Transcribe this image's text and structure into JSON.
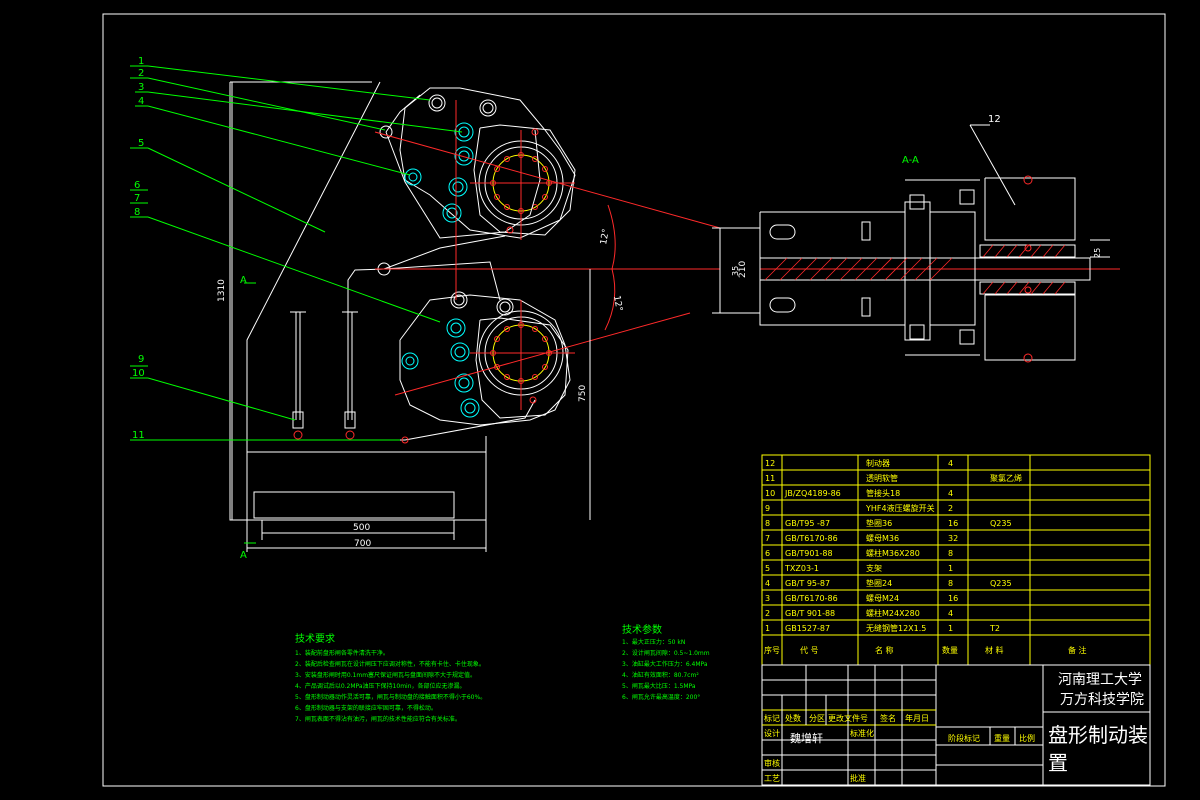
{
  "drawing": {
    "section_label": "A-A",
    "view_marker_top": "A",
    "view_marker_bottom": "A",
    "dimensions": {
      "height_total": "1310",
      "height_lower": "750",
      "width_500": "500",
      "width_700": "700",
      "angle_upper": "12°",
      "angle_lower": "12°",
      "gap_210": "210",
      "dim_35": "35",
      "dim_25": "25"
    },
    "callouts": [
      "1",
      "2",
      "3",
      "4",
      "5",
      "6",
      "7",
      "8",
      "9",
      "10",
      "11",
      "12"
    ]
  },
  "parts_table": {
    "header": {
      "seq": "序号",
      "code": "代 号",
      "name": "名 称",
      "qty": "数量",
      "material": "材 料",
      "note": "备 注"
    },
    "rows": [
      {
        "seq": "12",
        "code": "",
        "name": "制动器",
        "qty": "4",
        "material": "",
        "note": ""
      },
      {
        "seq": "11",
        "code": "",
        "name": "透明软管",
        "qty": "",
        "material": "",
        "note": "",
        "extra": "聚氯乙烯"
      },
      {
        "seq": "10",
        "code": "JB/ZQ4189-86",
        "name": "管接头18",
        "qty": "4",
        "material": "",
        "note": ""
      },
      {
        "seq": "9",
        "code": "",
        "name": "YHF4液压螺旋开关",
        "qty": "2",
        "material": "",
        "note": ""
      },
      {
        "seq": "8",
        "code": "GB/T95 -87",
        "name": "垫圈36",
        "qty": "16",
        "material": "Q235",
        "note": ""
      },
      {
        "seq": "7",
        "code": "GB/T6170-86",
        "name": "螺母M36",
        "qty": "32",
        "material": "",
        "note": ""
      },
      {
        "seq": "6",
        "code": "GB/T901-88",
        "name": "螺柱M36X280",
        "qty": "8",
        "material": "",
        "note": ""
      },
      {
        "seq": "5",
        "code": "TXZ03-1",
        "name": "支架",
        "qty": "1",
        "material": "",
        "note": ""
      },
      {
        "seq": "4",
        "code": "GB/T 95-87",
        "name": "垫圈24",
        "qty": "8",
        "material": "Q235",
        "note": ""
      },
      {
        "seq": "3",
        "code": "GB/T6170-86",
        "name": "螺母M24",
        "qty": "16",
        "material": "",
        "note": ""
      },
      {
        "seq": "2",
        "code": "GB/T 901-88",
        "name": "螺柱M24X280",
        "qty": "4",
        "material": "",
        "note": ""
      },
      {
        "seq": "1",
        "code": "GB1527-87",
        "name": "无缝钢管12X1.5",
        "qty": "1",
        "material": "T2",
        "note": ""
      }
    ]
  },
  "title_block": {
    "school_line1": "河南理工大学",
    "school_line2": "万方科技学院",
    "drawing_title_line1": "盘形制动装",
    "drawing_title_line2": "置",
    "labels": {
      "mark": "标记",
      "count": "处数",
      "zone": "分区",
      "change_doc": "更改文件号",
      "sign": "签名",
      "date": "年月日",
      "design": "设计",
      "standard": "标准化",
      "review": "审核",
      "process": "工艺",
      "approve": "批准",
      "stage": "阶段标记",
      "weight": "重量",
      "scale": "比例"
    },
    "designer": "魏增轩"
  },
  "notes": {
    "left_title": "技术要求",
    "left_lines": [
      "1、装配前盘形闸各零件清洗干净。",
      "2、装配后检查闸瓦在设计闸压下应调对称性，不能有卡住、卡住现象。",
      "3、安装盘形闸时用0.1mm塞尺保证闸瓦与盘面间隙不大于规定值。",
      "4、产品调试后以0.2MPa油压下保持10min，各部位应无渗漏。",
      "5、盘形制动器动作灵活可靠，闸瓦与制动盘的接触面积不得小于60%。",
      "6、盘形制动器与支架的联接应牢固可靠，不得松动。",
      "7、闸瓦表面不得沾有油污，闸瓦的技术性能应符合有关标准。"
    ],
    "right_title": "技术参数",
    "right_lines": [
      "1、最大正压力：50 kN",
      "2、设计闸瓦间隙：0.5~1.0mm",
      "3、油缸最大工作压力：6.4MPa",
      "4、油缸有效面积：80.7cm²",
      "5、闸瓦最大比压：1.5MPa",
      "6、闸瓦允许最高温度：200°"
    ]
  },
  "colors": {
    "background": "#000000",
    "outline": "#ffffff",
    "centerline": "#ff2a2a",
    "leader": "#00ff00",
    "text_table": "#ffff00",
    "fastener": "#00ffff"
  }
}
